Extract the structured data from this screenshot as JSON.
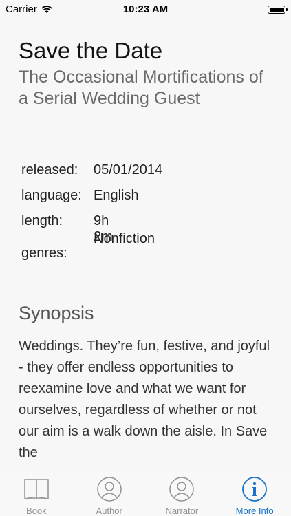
{
  "status_bar": {
    "carrier": "Carrier",
    "time": "10:23 AM"
  },
  "book": {
    "title": "Save the Date",
    "subtitle": "The Occasional Mortifications of a Serial Wedding Guest"
  },
  "details": {
    "released_label": "released:",
    "released_value": "05/01/2014",
    "language_label": "language:",
    "language_value": "English",
    "length_label": "length:",
    "length_value": "9h 2m",
    "genres_label": "genres:",
    "genres_value": "Nonfiction"
  },
  "synopsis": {
    "heading": "Synopsis",
    "text": "Weddings. They’re fun, festive, and joyful - they offer endless opportunities to reexamine love and what we want for ourselves, regardless of whether or not our aim is a walk down the aisle. In Save the"
  },
  "tabs": [
    {
      "label": "Book",
      "icon": "book-icon",
      "active": false
    },
    {
      "label": "Author",
      "icon": "person-icon",
      "active": false
    },
    {
      "label": "Narrator",
      "icon": "person-icon",
      "active": false
    },
    {
      "label": "More Info",
      "icon": "info-icon",
      "active": true
    }
  ],
  "colors": {
    "accent": "#1a73c8",
    "inactive": "#929292"
  }
}
